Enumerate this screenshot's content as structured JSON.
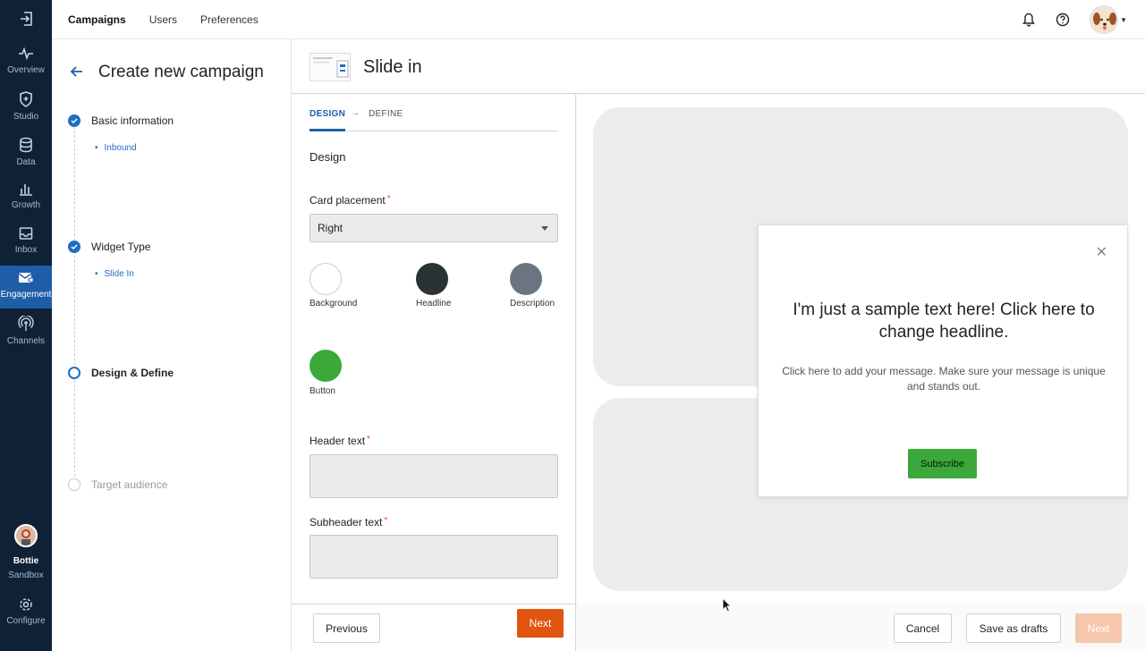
{
  "rail": {
    "items": [
      {
        "label": "Overview",
        "icon": "pulse-icon"
      },
      {
        "label": "Studio",
        "icon": "shield-icon"
      },
      {
        "label": "Data",
        "icon": "database-icon"
      },
      {
        "label": "Growth",
        "icon": "bar-chart-icon"
      },
      {
        "label": "Inbox",
        "icon": "inbox-icon"
      },
      {
        "label": "Engagement",
        "icon": "mail-megaphone-icon",
        "active": true
      },
      {
        "label": "Channels",
        "icon": "broadcast-icon"
      }
    ],
    "user_name": "Bottie",
    "workspace": "Sandbox",
    "configure_label": "Configure"
  },
  "topnav": {
    "items": [
      "Campaigns",
      "Users",
      "Preferences"
    ],
    "active": "Campaigns"
  },
  "steps": {
    "title": "Create new campaign",
    "items": [
      {
        "label": "Basic information",
        "status": "done",
        "sub": "Inbound"
      },
      {
        "label": "Widget Type",
        "status": "done",
        "sub": "Slide In"
      },
      {
        "label": "Design & Define",
        "status": "current"
      },
      {
        "label": "Target audience",
        "status": "todo"
      }
    ]
  },
  "main": {
    "title": "Slide in",
    "tabs": {
      "design": "DESIGN",
      "define": "DEFINE"
    },
    "section_title": "Design",
    "card_placement": {
      "label": "Card placement",
      "required_mark": "*",
      "value": "Right"
    },
    "colors": [
      {
        "label": "Background",
        "hex": "#ffffff"
      },
      {
        "label": "Headline",
        "hex": "#2b3236"
      },
      {
        "label": "Description",
        "hex": "#6a7581"
      },
      {
        "label": "Button",
        "hex": "#3aa93a"
      }
    ],
    "header_text": {
      "label": "Header text",
      "required_mark": "*"
    },
    "subheader_text": {
      "label": "Subheader text",
      "required_mark": "*"
    },
    "form_next": "Next"
  },
  "preview": {
    "headline": "I'm just a sample text here! Click here to change headline.",
    "description": "Click here to add your message. Make sure your message is unique and stands out.",
    "button": "Subscribe"
  },
  "footer": {
    "previous": "Previous",
    "cancel": "Cancel",
    "save_drafts": "Save as drafts",
    "next": "Next"
  },
  "colors": {
    "rail_bg": "#0f2235",
    "rail_active": "#1e5ea6",
    "accent_blue": "#1e6fc2",
    "primary_orange": "#e25510"
  }
}
